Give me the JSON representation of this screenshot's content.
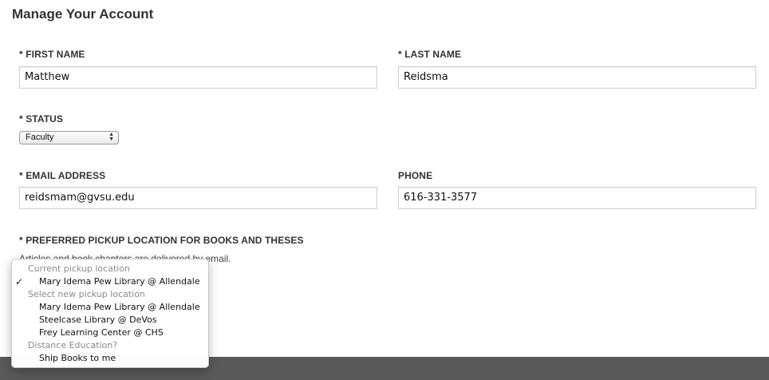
{
  "page": {
    "title": "Manage Your Account"
  },
  "form": {
    "first_name": {
      "label": "* FIRST NAME",
      "value": "Matthew"
    },
    "last_name": {
      "label": "* LAST NAME",
      "value": "Reidsma"
    },
    "status": {
      "label": "* STATUS",
      "selected": "Faculty"
    },
    "email": {
      "label": "* EMAIL ADDRESS",
      "value": "reidsmam@gvsu.edu"
    },
    "phone": {
      "label": "PHONE",
      "value": "616-331-3577"
    },
    "pickup": {
      "label": "* PREFERRED PICKUP LOCATION FOR BOOKS AND THESES",
      "note": "Articles and book chapters are delivered by email.",
      "menu": {
        "group_current": "Current pickup location",
        "current_option": "Mary Idema Pew Library @ Allendale",
        "check_mark": "✓",
        "group_new": "Select new pickup location",
        "new_options": [
          "Mary Idema Pew Library @ Allendale",
          "Steelcase Library @ DeVos",
          "Frey Learning Center @ CHS"
        ],
        "group_distance": "Distance Education?",
        "distance_option": "Ship Books to me"
      }
    }
  },
  "colors": {
    "text": "#333333",
    "footer": "#595959",
    "button_ghost": "#dce6f1",
    "input_border": "#cfcfcf"
  }
}
